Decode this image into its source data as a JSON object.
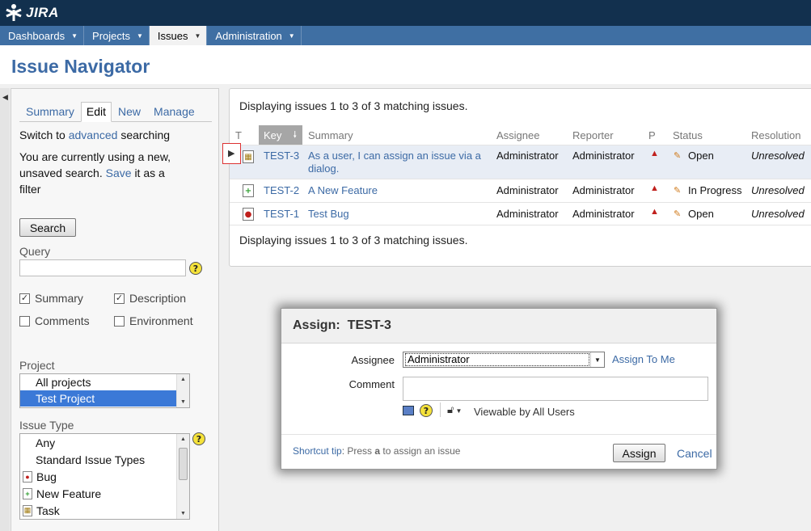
{
  "app": {
    "logo_text": "JIRA"
  },
  "nav": {
    "items": [
      {
        "label": "Dashboards",
        "active": false
      },
      {
        "label": "Projects",
        "active": false
      },
      {
        "label": "Issues",
        "active": true
      },
      {
        "label": "Administration",
        "active": false
      }
    ]
  },
  "page": {
    "title": "Issue Navigator"
  },
  "left_panel": {
    "tabs": [
      {
        "label": "Summary",
        "active": false
      },
      {
        "label": "Edit",
        "active": true
      },
      {
        "label": "New",
        "active": false
      },
      {
        "label": "Manage",
        "active": false
      }
    ],
    "switch_prefix": "Switch to",
    "switch_link": "advanced",
    "switch_suffix": "searching",
    "unsaved_line1": "You are currently using a new,",
    "unsaved_line2_prefix": "unsaved search.",
    "save_link": "Save",
    "unsaved_line2_suffix": "it as a",
    "unsaved_line3": "filter",
    "search_button": "Search",
    "query_label": "Query",
    "query_value": "",
    "checkboxes": [
      {
        "label": "Summary",
        "checked": true
      },
      {
        "label": "Description",
        "checked": true
      },
      {
        "label": "Comments",
        "checked": false
      },
      {
        "label": "Environment",
        "checked": false
      }
    ],
    "project_label": "Project",
    "projects": [
      {
        "label": "All projects",
        "selected": false
      },
      {
        "label": "Test Project",
        "selected": true
      }
    ],
    "issue_type_label": "Issue Type",
    "issue_types": [
      {
        "label": "Any",
        "icon": ""
      },
      {
        "label": "Standard Issue Types",
        "icon": ""
      },
      {
        "label": "Bug",
        "icon": "bug-icon"
      },
      {
        "label": "New Feature",
        "icon": "new-feature-icon"
      },
      {
        "label": "Task",
        "icon": "task-icon"
      }
    ]
  },
  "results": {
    "message": "Displaying issues 1 to 3 of 3 matching issues.",
    "columns": {
      "type": "T",
      "key": "Key",
      "summary": "Summary",
      "assignee": "Assignee",
      "reporter": "Reporter",
      "priority": "P",
      "status": "Status",
      "resolution": "Resolution"
    },
    "issues": [
      {
        "type_icon": "task-icon",
        "key": "TEST-3",
        "summary_line1": "As a user, I can assign an issue via a",
        "summary_line2": "dialog.",
        "assignee": "Administrator",
        "reporter": "Administrator",
        "priority_icon": "major-priority-icon",
        "status_icon": "open-status-icon",
        "status": "Open",
        "resolution": "Unresolved"
      },
      {
        "type_icon": "new-feature-icon",
        "key": "TEST-2",
        "summary_line1": "A New Feature",
        "summary_line2": "",
        "assignee": "Administrator",
        "reporter": "Administrator",
        "priority_icon": "major-priority-icon",
        "status_icon": "in-progress-status-icon",
        "status": "In Progress",
        "resolution": "Unresolved"
      },
      {
        "type_icon": "bug-icon",
        "key": "TEST-1",
        "summary_line1": "Test Bug",
        "summary_line2": "",
        "assignee": "Administrator",
        "reporter": "Administrator",
        "priority_icon": "major-priority-icon",
        "status_icon": "open-status-icon",
        "status": "Open",
        "resolution": "Unresolved"
      }
    ]
  },
  "dialog": {
    "title_prefix": "Assign:",
    "issue_key": "TEST-3",
    "assignee_label": "Assignee",
    "assignee_value": "Administrator",
    "assign_to_me": "Assign To Me",
    "comment_label": "Comment",
    "comment_value": "",
    "visibility": "Viewable by All Users",
    "shortcut_link": "Shortcut tip",
    "shortcut_text": ": Press",
    "shortcut_key": "a",
    "shortcut_suffix": "to assign an issue",
    "assign_button": "Assign",
    "cancel_link": "Cancel"
  },
  "colors": {
    "header_bg": "#12304e",
    "nav_bg": "#3f6fa3",
    "link": "#3c6aa5",
    "selection": "#3b79d7"
  }
}
